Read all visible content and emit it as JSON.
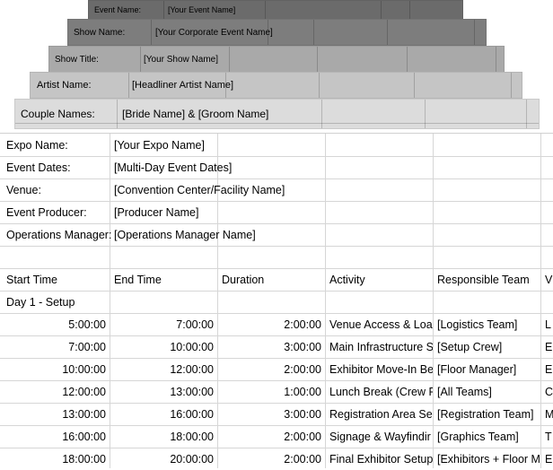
{
  "stacked_sheets": [
    {
      "label": "Event Name:",
      "value": "[Your Event Name]"
    },
    {
      "label": "Show Name:",
      "value": "[Your Corporate Event Name]"
    },
    {
      "label": "Show Title:",
      "value": "[Your Show Name]"
    },
    {
      "label": "Artist Name:",
      "value": "[Headliner Artist Name]"
    },
    {
      "label": "Couple Names:",
      "value": "[Bride Name] & [Groom Name]"
    }
  ],
  "info": [
    {
      "label": "Expo Name:",
      "value": "[Your Expo Name]"
    },
    {
      "label": "Event Dates:",
      "value": "[Multi-Day Event Dates]"
    },
    {
      "label": "Venue:",
      "value": "[Convention Center/Facility Name]"
    },
    {
      "label": "Event Producer:",
      "value": "[Producer Name]"
    },
    {
      "label": "Operations Manager:",
      "value": "[Operations Manager Name]"
    }
  ],
  "table": {
    "headers": [
      "Start Time",
      "End Time",
      "Duration",
      "Activity",
      "Responsible Team",
      "V"
    ],
    "section": "Day 1 - Setup",
    "rows": [
      [
        "5:00:00",
        "7:00:00",
        "2:00:00",
        "Venue Access & Loa",
        "[Logistics Team]",
        "L"
      ],
      [
        "7:00:00",
        "10:00:00",
        "3:00:00",
        "Main Infrastructure S",
        "[Setup Crew]",
        "E"
      ],
      [
        "10:00:00",
        "12:00:00",
        "2:00:00",
        "Exhibitor Move-In Be",
        "[Floor Manager]",
        "E"
      ],
      [
        "12:00:00",
        "13:00:00",
        "1:00:00",
        "Lunch Break (Crew R",
        "[All Teams]",
        "C"
      ],
      [
        "13:00:00",
        "16:00:00",
        "3:00:00",
        "Registration Area Se",
        "[Registration Team]",
        "M"
      ],
      [
        "16:00:00",
        "18:00:00",
        "2:00:00",
        "Signage & Wayfindir",
        "[Graphics Team]",
        "T"
      ],
      [
        "18:00:00",
        "20:00:00",
        "2:00:00",
        "Final Exhibitor Setup",
        "[Exhibitors + Floor M",
        "E"
      ]
    ]
  }
}
